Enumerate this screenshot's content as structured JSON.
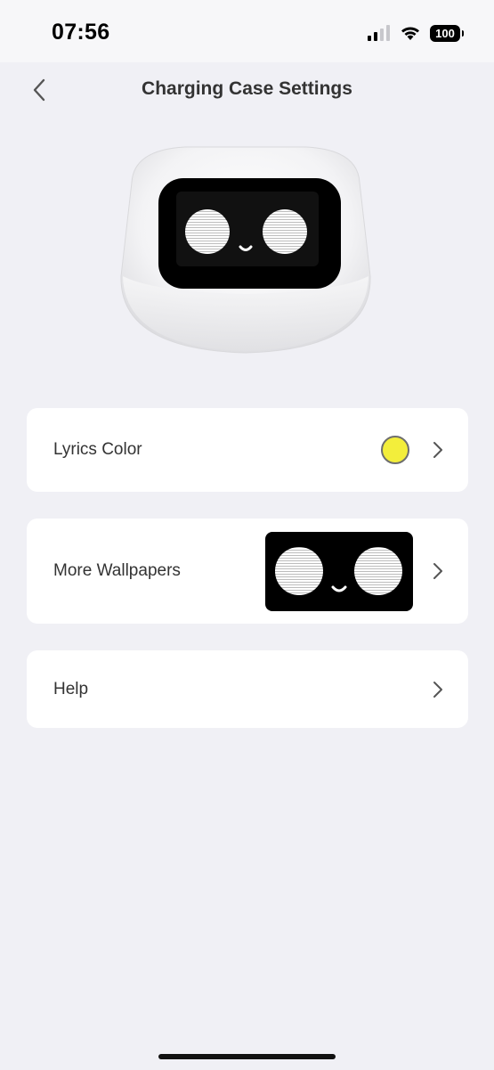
{
  "status_bar": {
    "time": "07:56",
    "battery": "100",
    "icons": [
      "signal-icon",
      "wifi-icon",
      "battery-icon"
    ]
  },
  "nav": {
    "title": "Charging Case Settings",
    "back_icon": "chevron-left-icon"
  },
  "device": {
    "image": "charging-case-robot-face"
  },
  "settings": {
    "lyrics_color": {
      "label": "Lyrics Color",
      "color": "#f3ee3b"
    },
    "more_wallpapers": {
      "label": "More Wallpapers",
      "thumbnail": "robot-eyes-wallpaper"
    },
    "help": {
      "label": "Help"
    }
  }
}
